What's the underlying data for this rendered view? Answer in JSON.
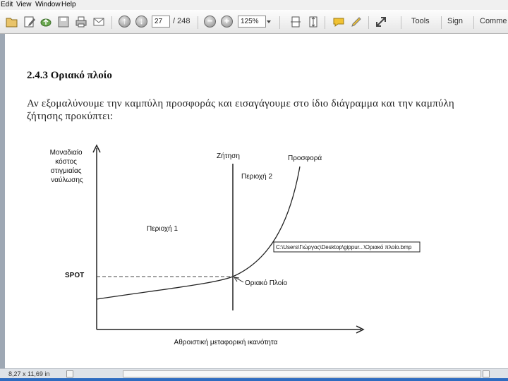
{
  "menu": {
    "items": [
      "Edit",
      "View",
      "Window",
      "Help"
    ]
  },
  "toolbar": {
    "page_number": "27",
    "page_total": "/ 248",
    "zoom": "125%",
    "tools_label": "Tools",
    "sign_label": "Sign",
    "comment_label": "Comme"
  },
  "document": {
    "heading": "2.4.3    Οριακό πλοίο",
    "paragraph": "Αν εξομαλύνουμε την καμπύλη προσφοράς και εισαγάγουμε στο ίδιο διάγραμμα και την καμπύλη ζήτησης προκύπτει:"
  },
  "figure": {
    "ylabel": [
      "Μοναδιαίο",
      "κόστος",
      "στιγμιαίας",
      "ναύλωσης"
    ],
    "xlabel": "Αθροιστική μεταφορική ικανότητα",
    "demand_label": "Ζήτηση",
    "supply_label": "Προσφορά",
    "region1_label": "Περιοχή 1",
    "region2_label": "Περιοχή 2",
    "spot_label": "SPOT",
    "marginal_label": "Οριακό Πλοίο",
    "tooltip_path": "C:\\Users\\Γιώργος\\Desktop\\gippur...\\Οριακό πλοίο.bmp"
  },
  "status": {
    "page_size": "8,27 x 11,69 in"
  },
  "colors": {
    "toolbar": "#e6e6e6",
    "status_accent": "#2e6cc0",
    "curve": "#222222"
  }
}
